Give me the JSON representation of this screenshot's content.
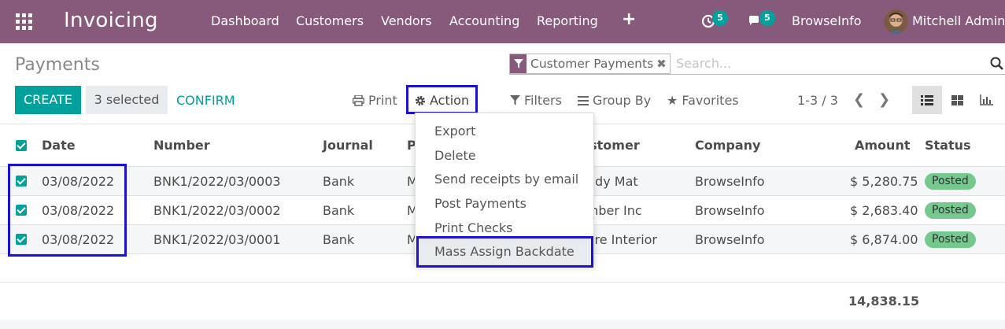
{
  "navbar": {
    "app_name": "Invoicing",
    "menu": [
      "Dashboard",
      "Customers",
      "Vendors",
      "Accounting",
      "Reporting"
    ],
    "activity_count": "5",
    "messages_count": "5",
    "company": "BrowseInfo",
    "user": "Mitchell Admin",
    "bg_color": "#875a7b"
  },
  "page": {
    "title": "Payments"
  },
  "search": {
    "facet_label": "Customer Payments",
    "placeholder": "Search..."
  },
  "toolbar": {
    "create_label": "CREATE",
    "selected_label": "3 selected",
    "confirm_label": "CONFIRM",
    "print_label": "Print",
    "action_label": "Action",
    "filters_label": "Filters",
    "group_by_label": "Group By",
    "favorites_label": "Favorites",
    "pager": "1-3 / 3"
  },
  "table": {
    "headers": {
      "date": "Date",
      "number": "Number",
      "journal": "Journal",
      "payment_method": "P",
      "customer": "Customer",
      "company": "Company",
      "amount": "Amount",
      "status": "Status"
    },
    "rows": [
      {
        "date": "03/08/2022",
        "number": "BNK1/2022/03/0003",
        "journal": "Bank",
        "payment_method": "M",
        "customer": "Ready Mat",
        "company": "BrowseInfo",
        "amount": "$ 5,280.75",
        "status": "Posted"
      },
      {
        "date": "03/08/2022",
        "number": "BNK1/2022/03/0002",
        "journal": "Bank",
        "payment_method": "M",
        "customer": "Lumber Inc",
        "company": "BrowseInfo",
        "amount": "$ 2,683.40",
        "status": "Posted"
      },
      {
        "date": "03/08/2022",
        "number": "BNK1/2022/03/0001",
        "journal": "Bank",
        "payment_method": "M",
        "customer": "Azure Interior",
        "company": "BrowseInfo",
        "amount": "$ 6,874.00",
        "status": "Posted"
      }
    ],
    "total": "14,838.15"
  },
  "action_menu": {
    "items": [
      "Export",
      "Delete",
      "Send receipts by email",
      "Post Payments",
      "Print Checks",
      "Mass Assign Backdate"
    ]
  },
  "colors": {
    "accent": "#00a09d",
    "highlight_box": "#1b13d1",
    "posted_badge": "#75c98f"
  }
}
